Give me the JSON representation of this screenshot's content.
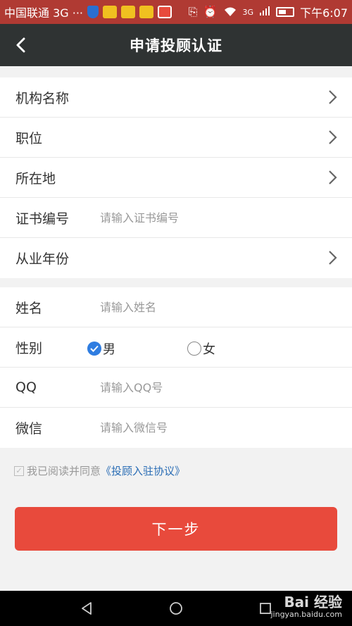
{
  "status_bar": {
    "carrier": "中国联通 3G ···",
    "network": "3G",
    "time": "下午6:07",
    "icons": [
      "shield-icon",
      "folder-icon",
      "folder-icon",
      "folder-icon",
      "notification-icon",
      "vibrate-icon",
      "alarm-icon",
      "wifi-icon",
      "signal-icon",
      "battery-icon"
    ]
  },
  "header": {
    "title": "申请投顾认证",
    "back_icon": "chevron-left-icon"
  },
  "group1": {
    "rows": [
      {
        "label": "机构名称",
        "type": "select"
      },
      {
        "label": "职位",
        "type": "select"
      },
      {
        "label": "所在地",
        "type": "select"
      },
      {
        "label": "证书编号",
        "type": "input",
        "placeholder": "请输入证书编号"
      },
      {
        "label": "从业年份",
        "type": "select"
      }
    ]
  },
  "group2": {
    "name": {
      "label": "姓名",
      "placeholder": "请输入姓名"
    },
    "gender": {
      "label": "性别",
      "male": "男",
      "female": "女",
      "selected": "男"
    },
    "qq": {
      "label": "QQ",
      "placeholder": "请输入QQ号"
    },
    "wechat": {
      "label": "微信",
      "placeholder": "请输入微信号"
    }
  },
  "agreement": {
    "text": "我已阅读并同意",
    "link": "《投顾入驻协议》",
    "checked": true
  },
  "next_button": {
    "label": "下一步"
  },
  "nav_bar": {
    "icons": [
      "back-triangle-icon",
      "home-circle-icon",
      "recents-square-icon"
    ]
  },
  "watermark": {
    "brand": "Bai 经验",
    "sub": "jingyan.baidu.com"
  },
  "colors": {
    "status_bar_bg": "#b03a33",
    "header_bg": "#2f3333",
    "primary_button": "#e84a3c",
    "radio_checked": "#2f7de1",
    "link": "#2a6db5"
  }
}
